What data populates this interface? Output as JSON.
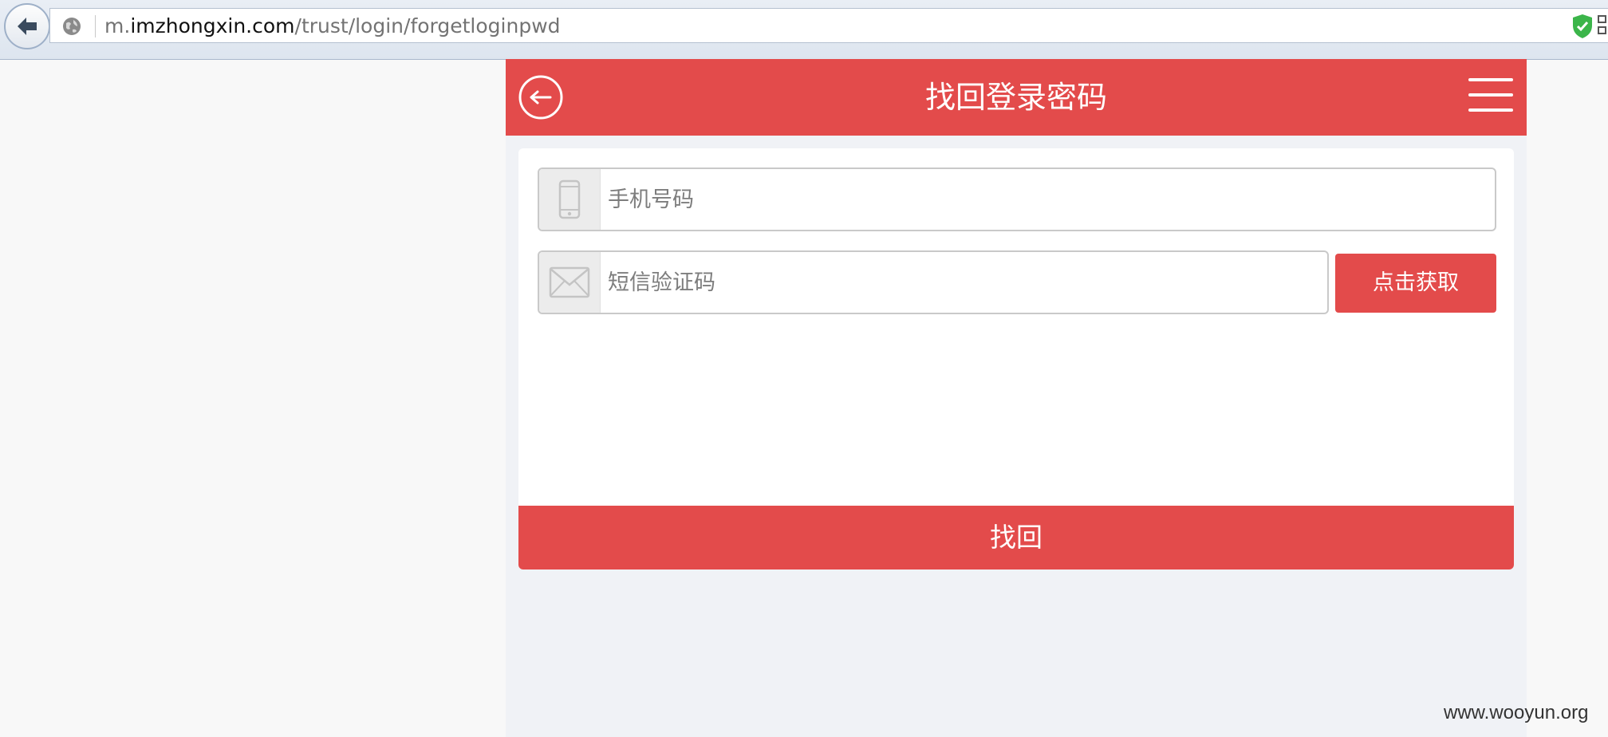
{
  "browser": {
    "url_prefix": "m.",
    "url_host": "imzhongxin.com",
    "url_path": "/trust/login/forgetloginpwd"
  },
  "header": {
    "title": "找回登录密码",
    "back_icon": "back-arrow-circle-icon",
    "menu_icon": "hamburger-menu-icon"
  },
  "form": {
    "phone": {
      "placeholder": "手机号码",
      "value": "",
      "icon": "mobile-phone-icon"
    },
    "sms_code": {
      "placeholder": "短信验证码",
      "value": "",
      "icon": "envelope-icon"
    },
    "get_code_label": "点击获取",
    "submit_label": "找回"
  },
  "watermark": "www.wooyun.org",
  "colors": {
    "accent": "#e34b4b",
    "page_bg": "#f0f2f6",
    "card_bg": "#ffffff"
  }
}
